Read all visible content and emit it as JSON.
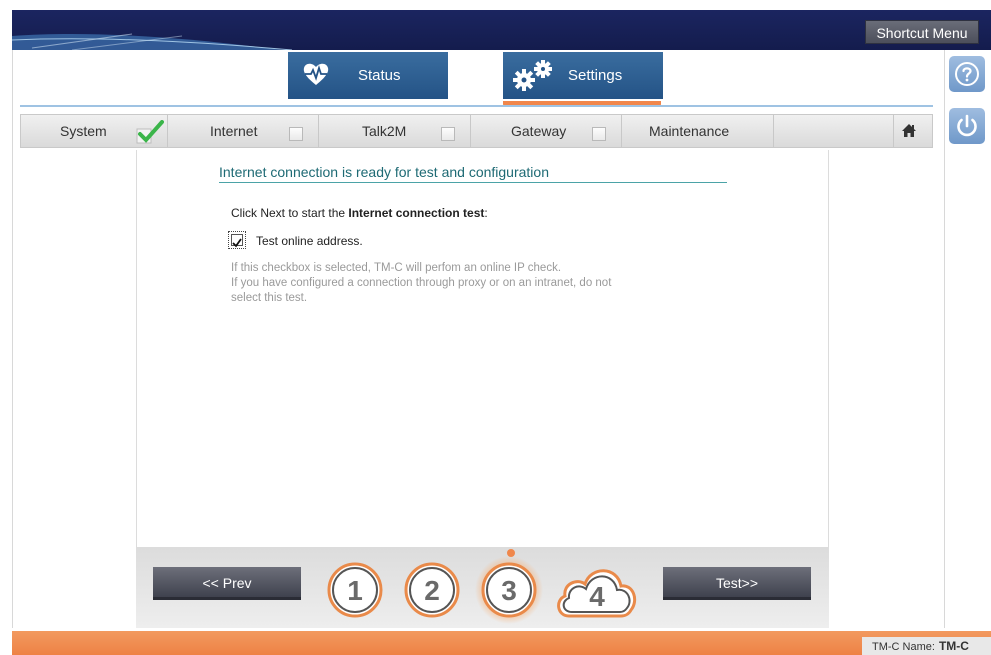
{
  "header": {
    "shortcut_label": "Shortcut Menu"
  },
  "main_tabs": [
    {
      "label": "Status",
      "icon": "heartbeat-icon"
    },
    {
      "label": "Settings",
      "icon": "gears-icon",
      "active": true
    }
  ],
  "steps": [
    {
      "label": "System",
      "done": true
    },
    {
      "label": "Internet",
      "done": false
    },
    {
      "label": "Talk2M",
      "done": false
    },
    {
      "label": "Gateway",
      "done": false
    },
    {
      "label": "Maintenance"
    }
  ],
  "content": {
    "heading": "Internet connection is ready for test and configuration",
    "intro_prefix": "Click Next to start the ",
    "intro_bold": "Internet connection test",
    "intro_suffix": ":",
    "checkbox_label": "Test online address.",
    "checkbox_checked": true,
    "note_line1": "If this checkbox is selected, TM-C will perfom an online IP check.",
    "note_line2": "If you have configured a connection through proxy or on an intranet, do not",
    "note_line3": "select this test."
  },
  "nav": {
    "prev_label": "<< Prev",
    "next_label": "Test>>",
    "wizard_steps": [
      "1",
      "2",
      "3",
      "4"
    ],
    "current_step": 3
  },
  "footer": {
    "name_label": "TM-C Name:",
    "name_value": "TM-C"
  },
  "colors": {
    "accent_orange": "#f0864b",
    "tab_blue": "#245386",
    "heading_teal": "#1e6a74",
    "header_navy": "#141c4d"
  }
}
